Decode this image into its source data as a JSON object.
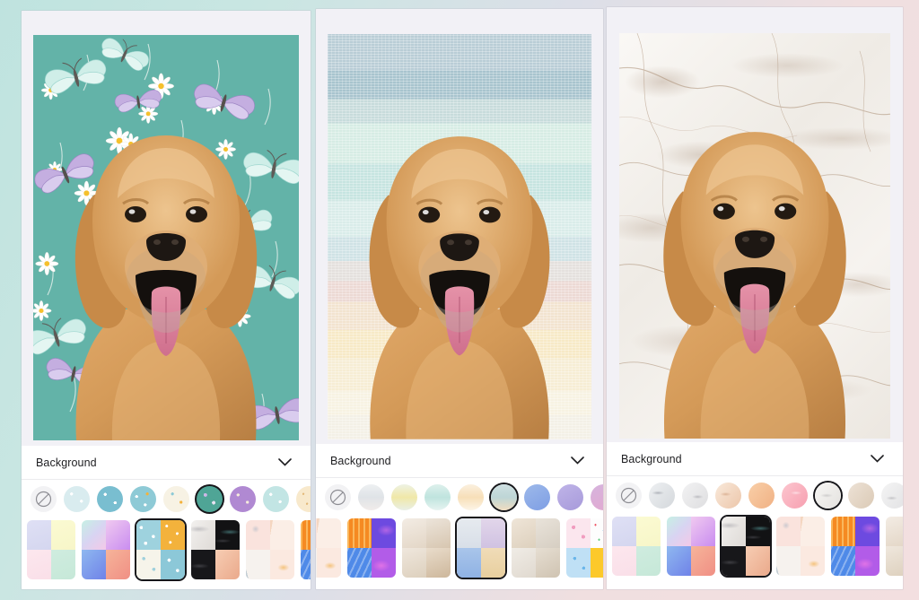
{
  "page": {
    "background_gradient": [
      "#bfe3df",
      "#dcdfe8",
      "#f3dfe0"
    ],
    "app_kind": "photo-background-editor",
    "panel_count": 3
  },
  "panels": [
    {
      "id": "panel-1",
      "subject": "golden-retriever-portrait",
      "background_style": "teal-butterflies-daisies",
      "background_color": "#63b3a8",
      "sheet": {
        "title": "Background",
        "collapse_icon": "chevron-down-icon",
        "swatches": [
          {
            "name": "none",
            "icon": "no-background-icon",
            "label": "None",
            "selected": false
          },
          {
            "name": "daisy-light",
            "label": "Light Daisy",
            "selected": false
          },
          {
            "name": "daisy-teal",
            "label": "Teal Daisy",
            "selected": false
          },
          {
            "name": "daisy-teal-2",
            "label": "Teal Bloom",
            "selected": false
          },
          {
            "name": "daisy-cream",
            "label": "Cream Daisy",
            "selected": false
          },
          {
            "name": "butterfly-teal",
            "label": "Butterfly Teal",
            "selected": true
          },
          {
            "name": "purple-floral",
            "label": "Purple Floral",
            "selected": false
          },
          {
            "name": "mint-dot",
            "label": "Mint Dot",
            "selected": false
          },
          {
            "name": "cream-dot",
            "label": "Cream Dot",
            "selected": false
          }
        ],
        "thumbnails": [
          {
            "name": "pastel-blocks",
            "label": "Pastel Blocks",
            "selected": false,
            "quads": [
              "q-lav",
              "q-cream",
              "q-pink",
              "q-mint"
            ]
          },
          {
            "name": "gradient-pack",
            "label": "Gradients",
            "selected": false,
            "quads": [
              "q-grad1",
              "q-grad2",
              "q-grad3",
              "q-grad4"
            ]
          },
          {
            "name": "daisy-pack",
            "label": "Daisies",
            "selected": true,
            "quads": [
              "q-daisyb",
              "q-daisyo",
              "q-daisyw",
              "q-daisyb2"
            ]
          },
          {
            "name": "marble-pack",
            "label": "Marble",
            "selected": false,
            "quads": [
              "q-marbw",
              "q-marbk",
              "q-marbk2",
              "q-marbp"
            ]
          },
          {
            "name": "boho-pack",
            "label": "Boho",
            "selected": false,
            "quads": [
              "q-boho1",
              "q-boho2",
              "q-boho3",
              "q-boho4"
            ]
          },
          {
            "name": "neon-pack",
            "label": "Neon",
            "selected": false,
            "quads": [
              "q-orange",
              "q-violet",
              "q-blue",
              "q-magenta"
            ]
          }
        ]
      }
    },
    {
      "id": "panel-2",
      "subject": "golden-retriever-portrait",
      "background_style": "watercolor-horizontal-bands",
      "background_color": "#cfe2e5",
      "sheet": {
        "title": "Background",
        "collapse_icon": "chevron-down-icon",
        "swatches": [
          {
            "name": "none",
            "icon": "no-background-icon",
            "label": "None",
            "selected": false
          },
          {
            "name": "watercolor-gray",
            "label": "Gray Wash",
            "selected": false
          },
          {
            "name": "watercolor-yellow",
            "label": "Yellow Wash",
            "selected": false
          },
          {
            "name": "watercolor-mint",
            "label": "Mint Wash",
            "selected": false
          },
          {
            "name": "watercolor-peach",
            "label": "Peach Wash",
            "selected": false
          },
          {
            "name": "watercolor-sunset",
            "label": "Sunset Wash",
            "selected": true
          },
          {
            "name": "watercolor-blue",
            "label": "Blue Wash",
            "selected": false
          },
          {
            "name": "watercolor-violet",
            "label": "Violet Wash",
            "selected": false
          },
          {
            "name": "watercolor-orchid",
            "label": "Orchid Wash",
            "selected": false
          }
        ],
        "thumbnails": [
          {
            "name": "boho-pack",
            "label": "Boho",
            "selected": false,
            "quads": [
              "q-boho1",
              "q-boho2",
              "q-boho3",
              "q-boho4"
            ]
          },
          {
            "name": "neon-pack",
            "label": "Neon",
            "selected": false,
            "quads": [
              "q-orange",
              "q-violet",
              "q-blue",
              "q-magenta"
            ]
          },
          {
            "name": "interior-pack",
            "label": "Interiors",
            "selected": false,
            "quads": [
              "q-room1",
              "q-room2",
              "q-room3",
              "q-room4"
            ]
          },
          {
            "name": "watercolor-pack",
            "label": "Watercolor",
            "selected": true,
            "quads": [
              "q-wc1",
              "q-wc2",
              "q-wc3",
              "q-wc4"
            ]
          },
          {
            "name": "neutral-pack",
            "label": "Neutrals",
            "selected": false,
            "quads": [
              "q-neu1",
              "q-neu2",
              "q-neu3",
              "q-neu4"
            ]
          },
          {
            "name": "confetti-pack",
            "label": "Confetti",
            "selected": false,
            "quads": [
              "q-conf1",
              "q-conf2",
              "q-conf3",
              "q-yellow"
            ]
          },
          {
            "name": "solid-pack",
            "label": "Solids",
            "selected": false,
            "quads": [
              "q-blue2",
              "q-blue2",
              "q-pinkred",
              "q-red"
            ]
          }
        ]
      }
    },
    {
      "id": "panel-3",
      "subject": "golden-retriever-portrait",
      "background_style": "white-marble",
      "background_color": "#f3f0ec",
      "sheet": {
        "title": "Background",
        "collapse_icon": "chevron-down-icon",
        "swatches": [
          {
            "name": "none",
            "icon": "no-background-icon",
            "label": "None",
            "selected": false
          },
          {
            "name": "marble-gray",
            "label": "Gray Marble",
            "selected": false
          },
          {
            "name": "marble-gray-2",
            "label": "Light Marble",
            "selected": false
          },
          {
            "name": "marble-tan",
            "label": "Tan Marble",
            "selected": false
          },
          {
            "name": "marble-peach",
            "label": "Peach Marble",
            "selected": false
          },
          {
            "name": "marble-pink",
            "label": "Pink Marble",
            "selected": false
          },
          {
            "name": "marble-white",
            "label": "White Marble",
            "selected": true
          },
          {
            "name": "marble-beige",
            "label": "Beige Marble",
            "selected": false
          },
          {
            "name": "marble-white-2",
            "label": "Snow Marble",
            "selected": false
          }
        ],
        "thumbnails": [
          {
            "name": "pastel-blocks",
            "label": "Pastel Blocks",
            "selected": false,
            "quads": [
              "q-lav",
              "q-cream",
              "q-pink",
              "q-mint"
            ]
          },
          {
            "name": "gradient-pack",
            "label": "Gradients",
            "selected": false,
            "quads": [
              "q-grad1",
              "q-grad2",
              "q-grad3",
              "q-grad4"
            ]
          },
          {
            "name": "marble-pack",
            "label": "Marble",
            "selected": true,
            "quads": [
              "q-marbw",
              "q-marbk",
              "q-marbk2",
              "q-marbp"
            ]
          },
          {
            "name": "boho-pack",
            "label": "Boho",
            "selected": false,
            "quads": [
              "q-boho1",
              "q-boho2",
              "q-boho3",
              "q-boho4"
            ]
          },
          {
            "name": "neon-pack",
            "label": "Neon",
            "selected": false,
            "quads": [
              "q-orange",
              "q-violet",
              "q-blue",
              "q-magenta"
            ]
          },
          {
            "name": "interior-pack",
            "label": "Interiors",
            "selected": false,
            "quads": [
              "q-room1",
              "q-room2",
              "q-room3",
              "q-room4"
            ]
          }
        ]
      }
    }
  ]
}
